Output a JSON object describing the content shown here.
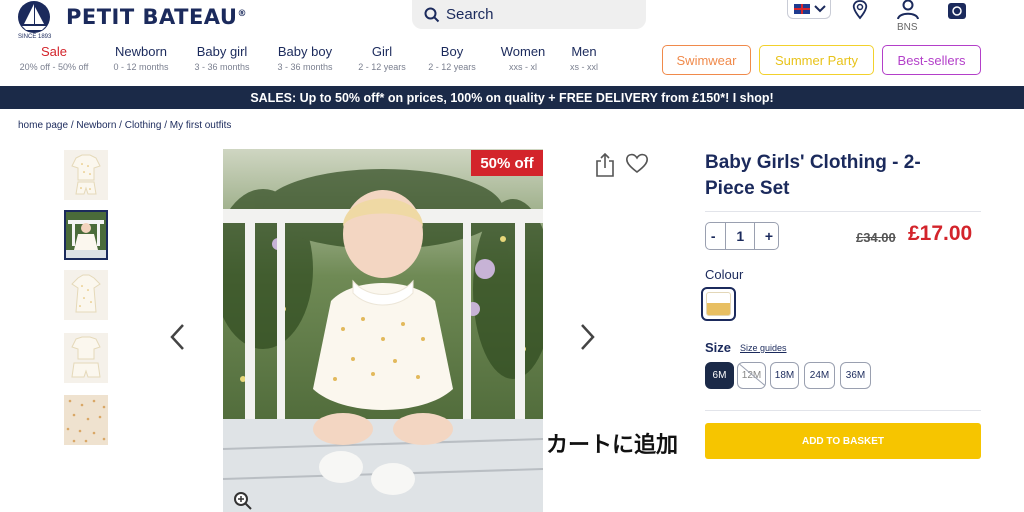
{
  "brand": {
    "name": "PETIT BATEAU",
    "registered": "®",
    "sub": "SINCE 1893"
  },
  "search": {
    "label": "Search"
  },
  "account": {
    "initials": "BNS"
  },
  "icons": {
    "search": "search-icon",
    "language": "uk-flag-icon",
    "chevron": "chevron-down-icon",
    "location": "location-pin-icon",
    "account": "user-icon",
    "basket": "basket-icon",
    "share": "share-icon",
    "wishlist": "heart-icon",
    "zoom": "zoom-icon",
    "prev": "chevron-left-icon",
    "next": "chevron-right-icon",
    "arrow": "red-arrow-icon"
  },
  "nav": [
    {
      "title": "Sale",
      "sub": "20% off - 50% off"
    },
    {
      "title": "Newborn",
      "sub": "0 - 12 months"
    },
    {
      "title": "Baby girl",
      "sub": "3 - 36 months"
    },
    {
      "title": "Baby boy",
      "sub": "3 - 36 months"
    },
    {
      "title": "Girl",
      "sub": "2 - 12 years"
    },
    {
      "title": "Boy",
      "sub": "2 - 12 years"
    },
    {
      "title": "Women",
      "sub": "xxs - xl"
    },
    {
      "title": "Men",
      "sub": "xs - xxl"
    }
  ],
  "pills": [
    {
      "label": "Swimwear",
      "color": "#f08a4b"
    },
    {
      "label": "Summer Party",
      "color": "#f2d12c"
    },
    {
      "label": "Best-sellers",
      "color": "#b33fc9"
    }
  ],
  "banner": "SALES: Up to 50% off* on prices, 100% on quality + FREE DELIVERY from £150*! I shop!",
  "breadcrumb": "home page / Newborn / Clothing / My first outfits",
  "product": {
    "badge": "50% off",
    "title": "Baby Girls' Clothing - 2-Piece Set",
    "qty_minus": "-",
    "qty": "1",
    "qty_plus": "+",
    "old_price": "£34.00",
    "price": "£17.00",
    "colour_label": "Colour",
    "size_label": "Size",
    "size_guide": "Size guides",
    "sizes": [
      {
        "label": "6M",
        "state": "selected"
      },
      {
        "label": "12M",
        "state": "unavailable"
      },
      {
        "label": "18M",
        "state": "available"
      },
      {
        "label": "24M",
        "state": "available"
      },
      {
        "label": "36M",
        "state": "available"
      }
    ],
    "add_to_basket": "ADD TO BASKET"
  },
  "annotation": "カートに追加",
  "colors": {
    "navy": "#1b2a5c",
    "sale_red": "#d3242b",
    "button_yellow": "#f6c500"
  }
}
